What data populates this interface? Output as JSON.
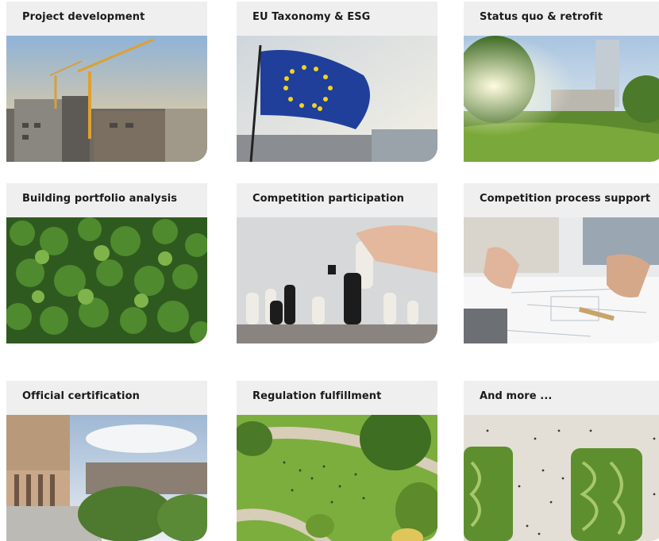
{
  "cards": [
    {
      "title": "Project development",
      "image": "construction-cranes-image"
    },
    {
      "title": "EU Taxonomy & ESG",
      "image": "eu-flag-image"
    },
    {
      "title": "Status quo & retrofit",
      "image": "park-tower-image"
    },
    {
      "title": "Building portfolio analysis",
      "image": "forest-aerial-image"
    },
    {
      "title": "Competition participation",
      "image": "chess-image"
    },
    {
      "title": "Competition process support",
      "image": "planning-desk-image"
    },
    {
      "title": "Official certification",
      "image": "green-building-image"
    },
    {
      "title": "Regulation fulfillment",
      "image": "park-aerial-image"
    },
    {
      "title": "And more ...",
      "image": "city-plaza-aerial-image"
    }
  ]
}
